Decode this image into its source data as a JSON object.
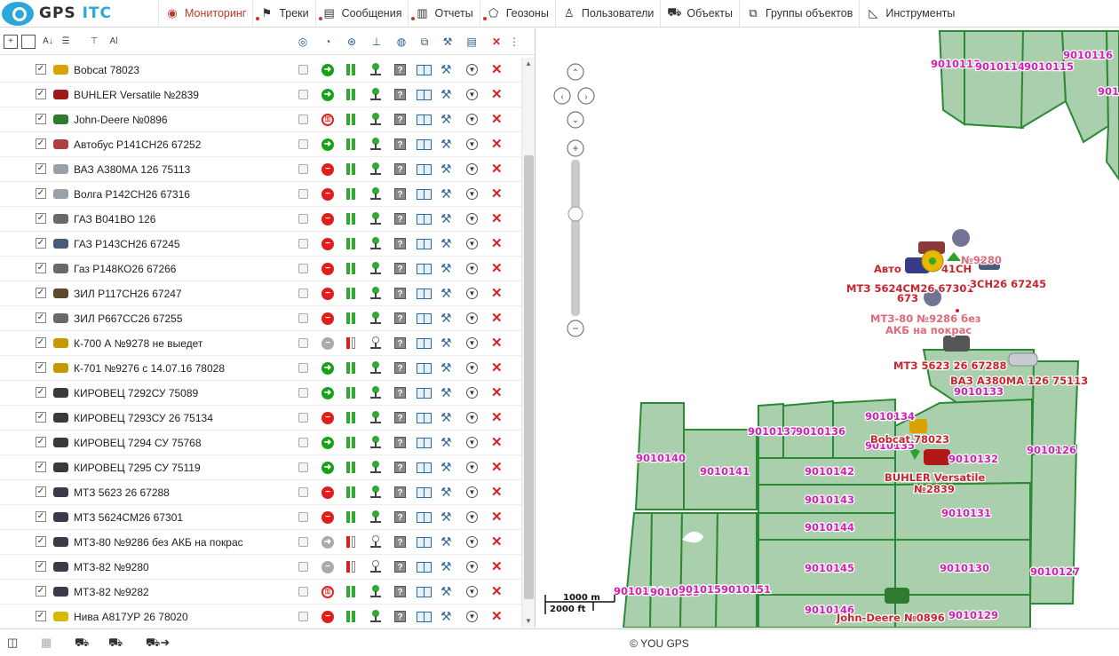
{
  "brand": {
    "logo_text_dark": "GPS ",
    "logo_text_blue": "ITC"
  },
  "menu": [
    {
      "label": "Мониторинг",
      "icon": "globe-icon",
      "active": true
    },
    {
      "label": "Треки",
      "icon": "flag-icon"
    },
    {
      "label": "Сообщения",
      "icon": "document-icon"
    },
    {
      "label": "Отчеты",
      "icon": "bar-chart-icon"
    },
    {
      "label": "Геозоны",
      "icon": "polygon-icon"
    },
    {
      "label": "Пользователи",
      "icon": "user-icon"
    },
    {
      "label": "Объекты",
      "icon": "car-icon"
    },
    {
      "label": "Группы объектов",
      "icon": "groups-icon"
    },
    {
      "label": "Инструменты",
      "icon": "ruler-icon"
    }
  ],
  "units": [
    {
      "name": "Bobcat 78023",
      "status": "go",
      "power": "on",
      "gps": "on",
      "icon_color": "#d6a300"
    },
    {
      "name": "BUHLER Versatile №2839",
      "status": "go",
      "power": "on",
      "gps": "on",
      "icon_color": "#a01818"
    },
    {
      "name": "John-Deere №0896",
      "status": "key",
      "power": "on",
      "gps": "on",
      "icon_color": "#2e7a2e"
    },
    {
      "name": "Автобус Р141СН26 67252",
      "status": "go",
      "power": "on",
      "gps": "on",
      "icon_color": "#b04040"
    },
    {
      "name": "ВАЗ А380МА 126 75113",
      "status": "stop",
      "power": "on",
      "gps": "on",
      "icon_color": "#9aa0a8"
    },
    {
      "name": "Волга Р142СН26 67316",
      "status": "stop",
      "power": "on",
      "gps": "on",
      "icon_color": "#9aa0a8"
    },
    {
      "name": "ГАЗ В041ВО 126",
      "status": "stop",
      "power": "on",
      "gps": "on",
      "icon_color": "#6a6a6a"
    },
    {
      "name": "ГАЗ Р143СН26 67245",
      "status": "stop",
      "power": "on",
      "gps": "on",
      "icon_color": "#4a5a7a"
    },
    {
      "name": "Газ Р148КО26 67266",
      "status": "stop",
      "power": "on",
      "gps": "on",
      "icon_color": "#6a6a6a"
    },
    {
      "name": "ЗИЛ Р117СН26 67247",
      "status": "stop",
      "power": "on",
      "gps": "on",
      "icon_color": "#5a4a2a"
    },
    {
      "name": "ЗИЛ Р667СС26 67255",
      "status": "stop",
      "power": "on",
      "gps": "on",
      "icon_color": "#6a6a6a"
    },
    {
      "name": "К-700 А №9278 не выедет",
      "status": "grey",
      "power": "off",
      "gps": "off",
      "icon_color": "#c49a00"
    },
    {
      "name": "К-701 №9276 с 14.07.16 78028",
      "status": "go",
      "power": "on",
      "gps": "on",
      "icon_color": "#c49a00"
    },
    {
      "name": "КИРОВЕЦ 7292СУ 75089",
      "status": "go",
      "power": "on",
      "gps": "on",
      "icon_color": "#3a3a3a"
    },
    {
      "name": "КИРОВЕЦ 7293СУ 26 75134",
      "status": "stop",
      "power": "on",
      "gps": "on",
      "icon_color": "#3a3a3a"
    },
    {
      "name": "КИРОВЕЦ 7294 СУ 75768",
      "status": "go",
      "power": "on",
      "gps": "on",
      "icon_color": "#3a3a3a"
    },
    {
      "name": "КИРОВЕЦ 7295 СУ 75119",
      "status": "go",
      "power": "on",
      "gps": "on",
      "icon_color": "#3a3a3a"
    },
    {
      "name": "МТЗ 5623 26 67288",
      "status": "stop",
      "power": "on",
      "gps": "on",
      "icon_color": "#3a3a4a"
    },
    {
      "name": "МТЗ 5624СМ26 67301",
      "status": "stop",
      "power": "on",
      "gps": "on",
      "icon_color": "#3a3a4a"
    },
    {
      "name": "МТЗ-80 №9286 без АКБ на покрас",
      "status": "grey-arrow",
      "power": "off",
      "gps": "off",
      "icon_color": "#3a3a4a"
    },
    {
      "name": "МТЗ-82 №9280",
      "status": "grey",
      "power": "off",
      "gps": "off",
      "icon_color": "#3a3a4a"
    },
    {
      "name": "МТЗ-82 №9282",
      "status": "key",
      "power": "on",
      "gps": "on",
      "icon_color": "#3a3a4a"
    },
    {
      "name": "Нива А817УР 26 78020",
      "status": "stop",
      "power": "on",
      "gps": "on",
      "icon_color": "#d6b800"
    }
  ],
  "map": {
    "field_labels": [
      "9010113",
      "9010114",
      "9010115",
      "9010116",
      "901",
      "9010133",
      "9010134",
      "9010137",
      "9010136",
      "9010135",
      "9010132",
      "9010126",
      "9010140",
      "9010141",
      "9010142",
      "9010143",
      "9010131",
      "9010144",
      "9010145",
      "9010130",
      "9010127",
      "9010154",
      "9010153",
      "9010152",
      "9010151",
      "9010146",
      "9010129"
    ],
    "object_labels": [
      "№9280",
      "Авто",
      "41СН",
      "МТЗ 5624СМ26 67301",
      "673",
      "3СН26 67245",
      "МТЗ-80 №9286 без",
      "АКБ на покрас",
      "МТЗ 5623 26 67288",
      "ВАЗ А380МА 126 75113",
      "Bobcat 78023",
      "BUHLER Versatile",
      "№2839",
      "John-Deere №0896"
    ],
    "scale_top": "1000 m",
    "scale_bottom": "2000 ft"
  },
  "footer": {
    "copyright": "© YOU GPS"
  },
  "colors": {
    "accent": "#c0392b",
    "field_fill": "#a9cfad",
    "field_stroke": "#2a8a33",
    "field_label": "#d21fb5",
    "object_label": "#c6242e"
  }
}
